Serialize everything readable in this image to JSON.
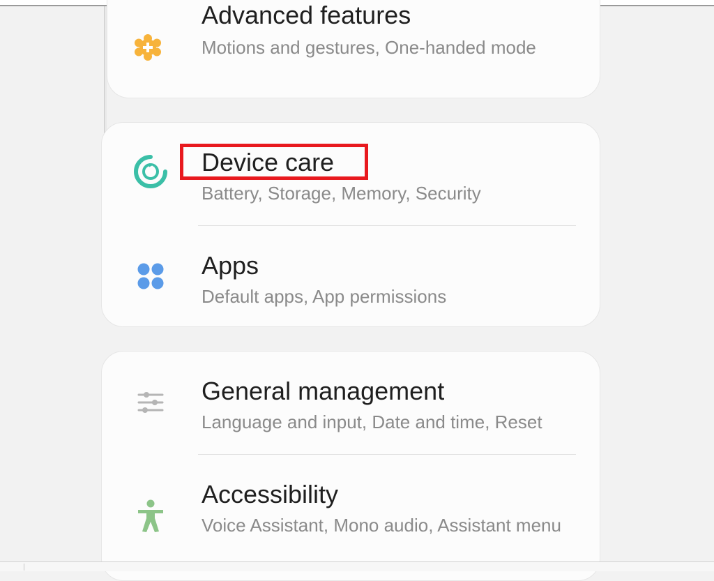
{
  "settings": {
    "advanced_features": {
      "title": "Advanced features",
      "subtitle": "Motions and gestures, One-handed mode",
      "icon": "advanced-features-gear-plus-icon",
      "icon_color": "#f7b33b"
    },
    "device_care": {
      "title": "Device care",
      "subtitle": "Battery, Storage, Memory, Security",
      "icon": "device-care-refresh-icon",
      "icon_color": "#3bbfa7"
    },
    "apps": {
      "title": "Apps",
      "subtitle": "Default apps, App permissions",
      "icon": "apps-grid-icon",
      "icon_color": "#5b9be8"
    },
    "general_management": {
      "title": "General management",
      "subtitle": "Language and input, Date and time, Reset",
      "icon": "sliders-icon",
      "icon_color": "#b5b5b5"
    },
    "accessibility": {
      "title": "Accessibility",
      "subtitle": "Voice Assistant, Mono audio, Assistant menu",
      "icon": "accessibility-person-icon",
      "icon_color": "#8cc488"
    }
  },
  "highlight": {
    "target": "Device care",
    "color": "#e8191e"
  },
  "colors": {
    "background": "#f2f2f2",
    "card": "#fcfcfc",
    "title_text": "#1f1f1f",
    "subtitle_text": "#8a8a8a"
  }
}
